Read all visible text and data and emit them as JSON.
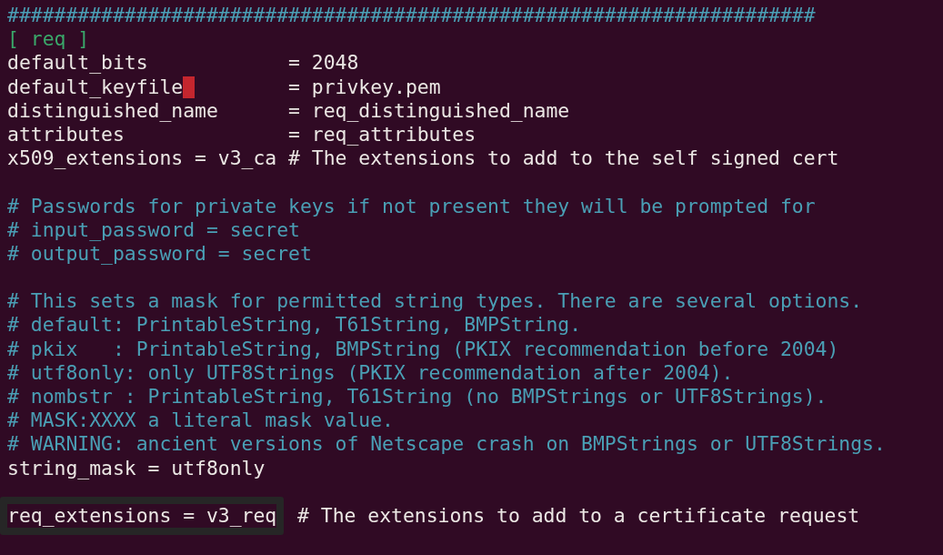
{
  "editor": {
    "lines": [
      {
        "kind": "text",
        "parts": [
          {
            "kind": "comment",
            "text": "#####################################################################"
          }
        ]
      },
      {
        "kind": "text",
        "parts": [
          {
            "kind": "section",
            "text": "[ req ]"
          }
        ]
      },
      {
        "kind": "text",
        "parts": [
          {
            "kind": "code",
            "text": "default_bits            = 2048"
          }
        ]
      },
      {
        "kind": "text",
        "parts": [
          {
            "kind": "code",
            "text": "default_keyfile",
            "cursor": true
          },
          {
            "kind": "code",
            "text": "        = privkey.pem"
          }
        ]
      },
      {
        "kind": "text",
        "parts": [
          {
            "kind": "code",
            "text": "distinguished_name      = req_distinguished_name"
          }
        ]
      },
      {
        "kind": "text",
        "parts": [
          {
            "kind": "code",
            "text": "attributes              = req_attributes"
          }
        ]
      },
      {
        "kind": "text",
        "parts": [
          {
            "kind": "code",
            "text": "x509_extensions = v3_ca # The extensions to add to the self signed cert"
          }
        ]
      },
      {
        "kind": "blank"
      },
      {
        "kind": "text",
        "parts": [
          {
            "kind": "comment",
            "text": "# Passwords for private keys if not present they will be prompted for"
          }
        ]
      },
      {
        "kind": "text",
        "parts": [
          {
            "kind": "comment",
            "text": "# input_password = secret"
          }
        ]
      },
      {
        "kind": "text",
        "parts": [
          {
            "kind": "comment",
            "text": "# output_password = secret"
          }
        ]
      },
      {
        "kind": "blank"
      },
      {
        "kind": "text",
        "parts": [
          {
            "kind": "comment",
            "text": "# This sets a mask for permitted string types. There are several options."
          }
        ]
      },
      {
        "kind": "text",
        "parts": [
          {
            "kind": "comment",
            "text": "# default: PrintableString, T61String, BMPString."
          }
        ]
      },
      {
        "kind": "text",
        "parts": [
          {
            "kind": "comment",
            "text": "# pkix   : PrintableString, BMPString (PKIX recommendation before 2004)"
          }
        ]
      },
      {
        "kind": "text",
        "parts": [
          {
            "kind": "comment",
            "text": "# utf8only: only UTF8Strings (PKIX recommendation after 2004)."
          }
        ]
      },
      {
        "kind": "text",
        "parts": [
          {
            "kind": "comment",
            "text": "# nombstr : PrintableString, T61String (no BMPStrings or UTF8Strings)."
          }
        ]
      },
      {
        "kind": "text",
        "parts": [
          {
            "kind": "comment",
            "text": "# MASK:XXXX a literal mask value."
          }
        ]
      },
      {
        "kind": "text",
        "parts": [
          {
            "kind": "comment",
            "text": "# WARNING: ancient versions of Netscape crash on BMPStrings or UTF8Strings."
          }
        ]
      },
      {
        "kind": "text",
        "parts": [
          {
            "kind": "code",
            "text": "string_mask = utf8only"
          }
        ]
      },
      {
        "kind": "blank"
      },
      {
        "kind": "text",
        "parts": [
          {
            "kind": "code",
            "text": "req_extensions = v3_req",
            "highlighted": true
          },
          {
            "kind": "code",
            "text": " # The extensions to add to a certificate request"
          }
        ]
      }
    ]
  }
}
